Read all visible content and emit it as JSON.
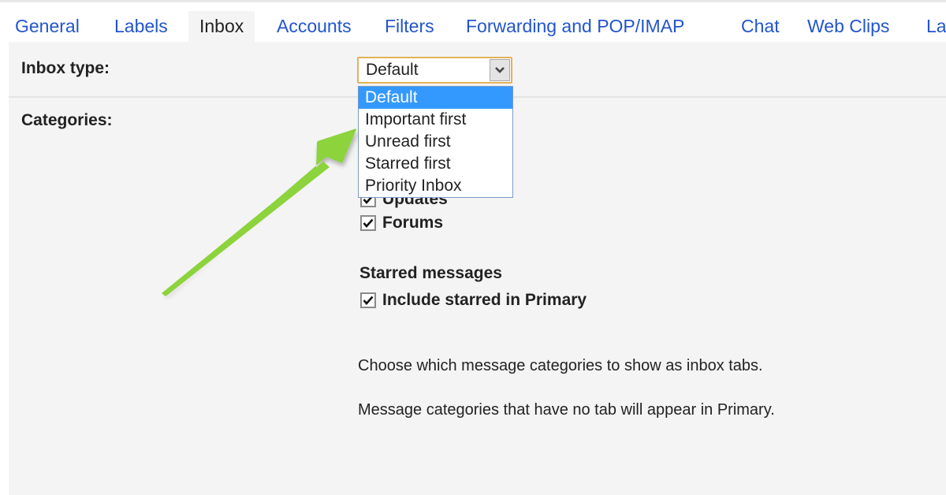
{
  "tabs": [
    {
      "label": "General",
      "active": false
    },
    {
      "label": "Labels",
      "active": false
    },
    {
      "label": "Inbox",
      "active": true
    },
    {
      "label": "Accounts",
      "active": false
    },
    {
      "label": "Filters",
      "active": false
    },
    {
      "label": "Forwarding and POP/IMAP",
      "active": false
    },
    {
      "label": "Chat",
      "active": false
    },
    {
      "label": "Web Clips",
      "active": false
    },
    {
      "label": "La",
      "active": false
    }
  ],
  "inbox_type": {
    "label": "Inbox type:",
    "selected": "Default",
    "options": [
      "Default",
      "Important first",
      "Unread first",
      "Starred first",
      "Priority Inbox"
    ],
    "arrow_icon": "chevron-down-icon"
  },
  "categories": {
    "label": "Categories:",
    "items": [
      {
        "label": "Updates",
        "checked": true
      },
      {
        "label": "Forums",
        "checked": true
      }
    ]
  },
  "starred": {
    "title": "Starred messages",
    "option": {
      "label": "Include starred in Primary",
      "checked": true
    }
  },
  "descriptions": [
    "Choose which message categories to show as inbox tabs.",
    "Message categories that have no tab will appear in Primary."
  ],
  "annotation": {
    "type": "arrow",
    "color": "#8cd33c",
    "points_to": "inbox type dropdown"
  }
}
